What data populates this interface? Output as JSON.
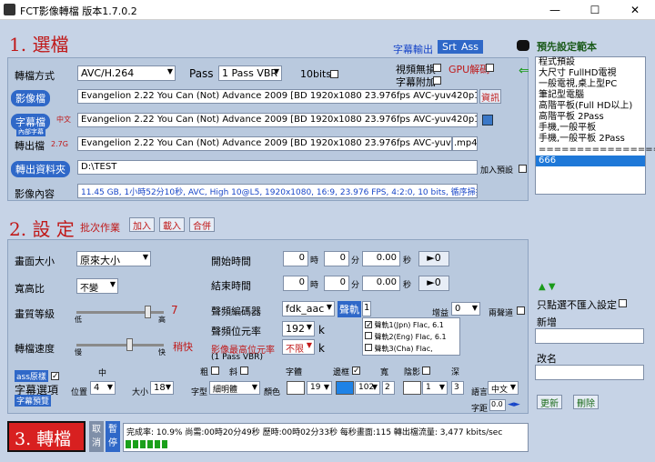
{
  "window": {
    "title": "FCT影像轉檔 版本1.7.0.2",
    "min": "—",
    "max": "☐",
    "close": "✕"
  },
  "section1": {
    "title": "1. 選檔",
    "subtitle_output": "字幕輸出",
    "srt": "Srt",
    "ass": "Ass",
    "format_label": "轉檔方式",
    "format_value": "AVC/H.264",
    "pass_label": "Pass",
    "pass_value": "1 Pass VBR",
    "tenbit_label": "10bits",
    "video_noreact": "視頻無損",
    "gpu_decode": "GPU解碼",
    "subtitle_add": "字幕附加",
    "video_file_label": "影像檔",
    "video_file_value": "Evangelion 2.22 You Can (Not) Advance 2009 [BD 1920x1080 23.976fps AVC-yuv420p10 FLAC].mkv",
    "info_btn": "資訊",
    "subtitle_file_label": "字幕檔",
    "subtitle_sub": "內部字幕",
    "subtitle_lang": "中文",
    "subtitle_file_value": "Evangelion 2.22 You Can (Not) Advance 2009 [BD 1920x1080 23.976fps AVC-yuv420p10 FLAC].ass",
    "output_file_label": "轉出檔",
    "output_size": "2.7G",
    "output_file_value": "Evangelion 2.22 You Can (Not) Advance 2009 [BD 1920x1080 23.976fps AVC-yuv420p10 FLAC]_f",
    "output_ext": ".mp4",
    "output_folder_label": "轉出資料夾",
    "output_folder_value": "D:\\TEST",
    "add_preset": "加入預設",
    "content_label": "影像內容",
    "content_value": "11.45 GB, 1小時52分10秒, AVC, High 10@L5, 1920x1080, 16:9, 23.976 FPS, 4:2:0, 10 bits, 循序掃描"
  },
  "presets": {
    "title": "預先設定範本",
    "items": [
      "程式預設",
      "大尺寸 FullHD電視",
      "一般電視,桌上型PC",
      "筆記型電腦",
      "高階平板(Full HD以上)",
      "高階平板 2Pass",
      "手機,一般平板",
      "手機,一般平板 2Pass",
      "================",
      "666"
    ],
    "selected": "666",
    "click_no_set": "只點選不匯入設定",
    "new_label": "新增",
    "rename_label": "改名",
    "update_btn": "更新",
    "delete_btn": "刪除"
  },
  "section2": {
    "title": "2. 設 定",
    "batch": "批次作業",
    "add": "加入",
    "load": "載入",
    "merge": "合併",
    "size_label": "畫面大小",
    "size_value": "原來大小",
    "ratio_label": "寬高比",
    "ratio_value": "不變",
    "quality_label": "畫質等級",
    "quality_low": "低",
    "quality_high": "高",
    "quality_num": "7",
    "quality_level": 0.85,
    "speed_label": "轉檔速度",
    "speed_slow": "慢",
    "speed_fast": "快",
    "speed_value": "稍快",
    "speed_level": 0.62,
    "start_label": "開始時間",
    "end_label": "結束時間",
    "hour": "時",
    "minute": "分",
    "second": "秒",
    "zero": "0",
    "sec_zero": "0.00",
    "jump_btn": "►0",
    "audio_codec_label": "聲頻編碼器",
    "audio_codec_value": "fdk_aac",
    "audio_track_label": "聲軌",
    "audio_track_num": "1",
    "gain_label": "增益",
    "gain_value": "0",
    "two_channel": "兩聲道",
    "audio_bitrate_label": "聲頻位元率",
    "audio_bitrate_value": "192",
    "k": "k",
    "video_max_label": "影像最高位元率",
    "video_max_value": "不限",
    "video_max_note": "(1 Pass VBR)",
    "tracks": [
      "聲軌1(Jpn) Flac, 6.1",
      "聲軌2(Eng) Flac, 6.1",
      "聲軌3(Cha) Flac, Stereo"
    ],
    "ass_origin": "ass原樣",
    "subtitle_opts": "字幕選項",
    "subtitle_preview": "字幕預覽",
    "mid": "中",
    "position_label": "位置",
    "position_value": "4",
    "size_font_label": "大小",
    "size_font_value": "18",
    "font_label": "字型",
    "font_value": "細明體",
    "bold": "粗",
    "italic": "斜",
    "color_label": "顏色",
    "color_value": "19",
    "font2_label": "字體",
    "border_label": "邊框",
    "border_value": "102",
    "width_label": "寬",
    "width_value": "2",
    "shadow_label": "陰影",
    "shadow_value": "1",
    "depth_label": "深",
    "depth_value": "3",
    "lang_label": "語言",
    "lang_value": "中文",
    "spacing_label": "字距",
    "spacing_value": "0.0"
  },
  "section3": {
    "title": "3. 轉檔",
    "cancel": "取消",
    "pause": "暫停",
    "status": "完成率: 10.9% 尚需:00時20分49秒 歷時:00時02分33秒 每秒畫面:115 轉出檔流量: 3,477 kbits/sec",
    "progress": 0.109
  },
  "colors": {
    "accent": "#2f68c8",
    "title_red": "#c01818",
    "progress": "#1aa01a"
  }
}
